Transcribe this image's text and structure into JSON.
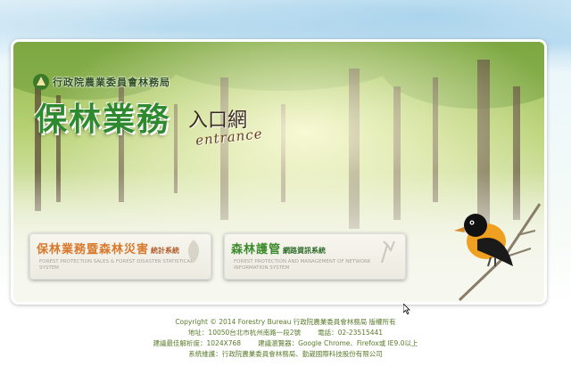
{
  "header": {
    "agency_name": "行政院農業委員會林務局",
    "title_main": "保林業務",
    "title_sub": "入口網",
    "title_en": "entrance"
  },
  "buttons": [
    {
      "label": "保林業務暨森林災害",
      "label_suffix": "統計系統",
      "subtitle": "FOREST PROTECTION SALES & FOREST DISASTER STATISTICAL SYSTEM"
    },
    {
      "label": "森林護管",
      "label_suffix": "網路資訊系統",
      "subtitle": "FOREST PROTECTION AND MANAGEMENT OF NETWORK INFORMATION SYSTEM"
    }
  ],
  "footer": {
    "copyright": "Copyright © 2014 Forestry Bureau 行政院農業委員會林務局 版權所有",
    "address": "地址：10050台北市杭州南路一段2號",
    "phone": "電話：02-23515441",
    "resolution": "建議最佳解析度：1024X768",
    "browser": "建議瀏覽器：Google Chrome、Firefox或 IE9.0以上",
    "maintainer": "系統維護：行政院農業委員會林務局、勤崴國際科技股份有限公司"
  },
  "colors": {
    "title_green": "#2f8a2f",
    "button1_accent": "#d8782a",
    "button2_accent": "#3b8a2c",
    "footer_text": "#5a7a2a"
  },
  "icons": {
    "agency_logo": "forestry-bureau-logo",
    "bird": "bird-illustration",
    "cursor": "mouse-pointer"
  }
}
